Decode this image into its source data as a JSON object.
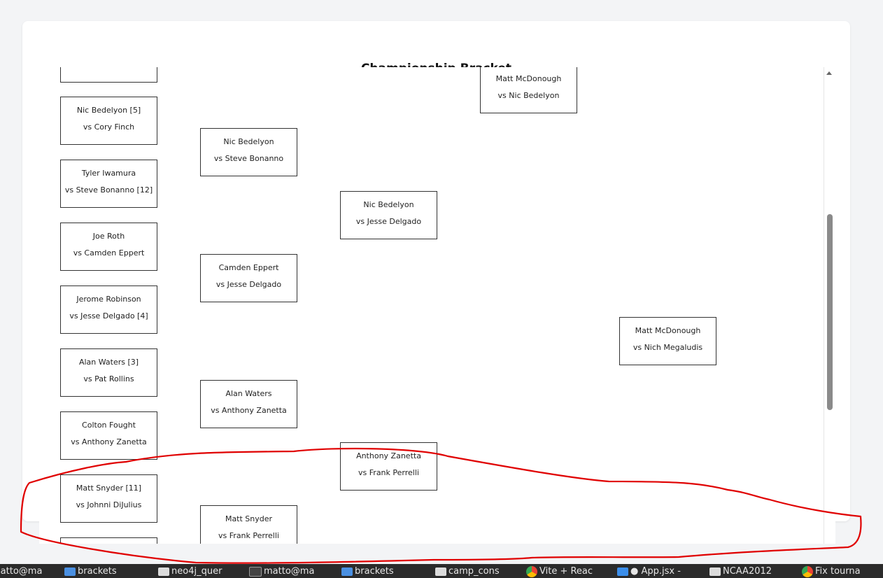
{
  "card": {
    "title": "Championship Bracket"
  },
  "matches": [
    {
      "line1": "",
      "line2": ""
    },
    {
      "line1": "Nic Bedelyon [5]",
      "line2": "vs Cory Finch"
    },
    {
      "line1": "Tyler Iwamura",
      "line2": "vs Steve Bonanno [12]"
    },
    {
      "line1": "Joe Roth",
      "line2": "vs Camden Eppert"
    },
    {
      "line1": "Jerome Robinson",
      "line2": "vs Jesse Delgado [4]"
    },
    {
      "line1": "Alan Waters [3]",
      "line2": "vs Pat Rollins"
    },
    {
      "line1": "Colton Fought",
      "line2": "vs Anthony Zanetta"
    },
    {
      "line1": "Matt Snyder [11]",
      "line2": "vs Johnni DiJulius"
    },
    {
      "line1": "",
      "line2": ""
    },
    {
      "line1": "Nic Bedelyon",
      "line2": "vs Steve Bonanno"
    },
    {
      "line1": "Camden Eppert",
      "line2": "vs Jesse Delgado"
    },
    {
      "line1": "Alan Waters",
      "line2": "vs Anthony Zanetta"
    },
    {
      "line1": "Matt Snyder",
      "line2": "vs Frank Perrelli"
    },
    {
      "line1": "Nic Bedelyon",
      "line2": "vs Jesse Delgado"
    },
    {
      "line1": "Anthony Zanetta",
      "line2": "vs Frank Perrelli"
    },
    {
      "line1": "Matt McDonough",
      "line2": "vs Nic Bedelyon"
    },
    {
      "line1": "Matt McDonough",
      "line2": "vs Nich Megaludis"
    }
  ],
  "taskbar": [
    {
      "label": "matto@ma",
      "icon": "terminal-icon"
    },
    {
      "label": "brackets",
      "icon": "folder-icon"
    },
    {
      "label": "neo4j_quer",
      "icon": "document-icon"
    },
    {
      "label": "matto@ma",
      "icon": "terminal-icon"
    },
    {
      "label": "brackets",
      "icon": "folder-icon"
    },
    {
      "label": "camp_cons",
      "icon": "document-icon"
    },
    {
      "label": "Vite + Reac",
      "icon": "chrome-icon"
    },
    {
      "label": "● App.jsx -",
      "icon": "vscode-icon"
    },
    {
      "label": "NCAA2012",
      "icon": "document-icon"
    },
    {
      "label": "Fix tourna",
      "icon": "chrome-icon"
    }
  ],
  "colors": {
    "annotation": "#e00000",
    "taskbar": "#2b2b2b",
    "page_bg": "#f3f4f6"
  }
}
